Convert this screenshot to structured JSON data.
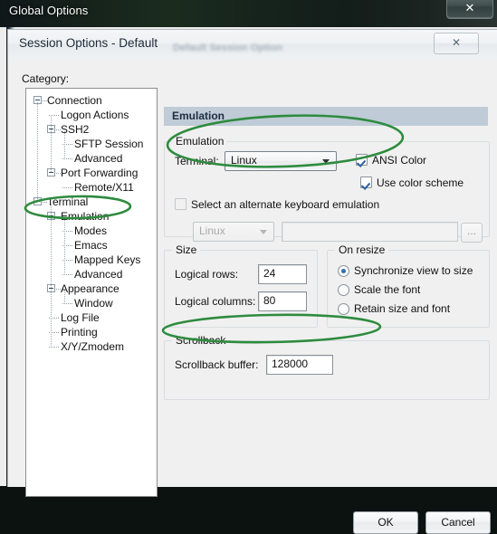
{
  "outer_window": {
    "title": "Global Options",
    "close_label": "✕"
  },
  "dialog": {
    "title": "Session Options - Default",
    "ghost_title": "Default Session Option",
    "close_label": "✕"
  },
  "category": {
    "label": "Category:",
    "tree": [
      {
        "label": "Connection",
        "depth": 0,
        "expandable": true
      },
      {
        "label": "Logon Actions",
        "depth": 1,
        "expandable": false
      },
      {
        "label": "SSH2",
        "depth": 1,
        "expandable": true
      },
      {
        "label": "SFTP Session",
        "depth": 2,
        "expandable": false
      },
      {
        "label": "Advanced",
        "depth": 2,
        "expandable": false
      },
      {
        "label": "Port Forwarding",
        "depth": 1,
        "expandable": true
      },
      {
        "label": "Remote/X11",
        "depth": 2,
        "expandable": false
      },
      {
        "label": "Terminal",
        "depth": 0,
        "expandable": true
      },
      {
        "label": "Emulation",
        "depth": 1,
        "expandable": true,
        "selected": true
      },
      {
        "label": "Modes",
        "depth": 2,
        "expandable": false
      },
      {
        "label": "Emacs",
        "depth": 2,
        "expandable": false
      },
      {
        "label": "Mapped Keys",
        "depth": 2,
        "expandable": false
      },
      {
        "label": "Advanced",
        "depth": 2,
        "expandable": false
      },
      {
        "label": "Appearance",
        "depth": 1,
        "expandable": true
      },
      {
        "label": "Window",
        "depth": 2,
        "expandable": false
      },
      {
        "label": "Log File",
        "depth": 1,
        "expandable": false
      },
      {
        "label": "Printing",
        "depth": 1,
        "expandable": false
      },
      {
        "label": "X/Y/Zmodem",
        "depth": 1,
        "expandable": false
      }
    ]
  },
  "page": {
    "header": "Emulation",
    "emulation_group": {
      "title": "Emulation",
      "terminal_label": "Terminal:",
      "terminal_value": "Linux",
      "ansi_color_label": "ANSI Color",
      "ansi_color_checked": true,
      "use_color_scheme_label": "Use color scheme",
      "use_color_scheme_checked": true,
      "alt_keyboard_label": "Select an alternate keyboard emulation",
      "alt_keyboard_checked": false,
      "alt_keyboard_value": "Linux",
      "alt_keyboard_path": "",
      "browse_label": "..."
    },
    "size_group": {
      "title": "Size",
      "rows_label": "Logical rows:",
      "rows_value": "24",
      "cols_label": "Logical columns:",
      "cols_value": "80"
    },
    "resize_group": {
      "title": "On resize",
      "options": [
        {
          "label": "Synchronize view to size",
          "selected": true
        },
        {
          "label": "Scale the font",
          "selected": false
        },
        {
          "label": "Retain size and font",
          "selected": false
        }
      ]
    },
    "scrollback_group": {
      "title": "Scrollback",
      "buffer_label": "Scrollback buffer:",
      "buffer_value": "128000"
    }
  },
  "footer": {
    "ok_label": "OK",
    "cancel_label": "Cancel"
  },
  "annotations": {
    "marker_color": "#2e8b3f",
    "ellipses": [
      "emulation-tree-node",
      "terminal-row",
      "scrollback-buffer-row"
    ]
  }
}
